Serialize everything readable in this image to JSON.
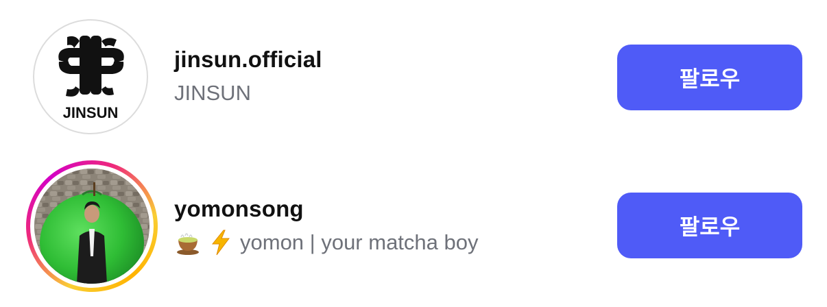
{
  "suggestions": [
    {
      "username": "jinsun.official",
      "subtitle": "JINSUN",
      "logo_text": "JINSUN",
      "follow_label": "팔로우",
      "has_story": false
    },
    {
      "username": "yomonsong",
      "subtitle_emoji": [
        "teacup-icon",
        "lightning-icon"
      ],
      "subtitle": "yomon | your matcha boy",
      "follow_label": "팔로우",
      "has_story": true
    }
  ],
  "colors": {
    "follow_button": "#4f5bf7",
    "username": "#111111",
    "subtitle": "#6e7179",
    "story_ring_start": "#f9ce34",
    "story_ring_mid": "#ee2a7b",
    "story_ring_end": "#d300c5"
  }
}
